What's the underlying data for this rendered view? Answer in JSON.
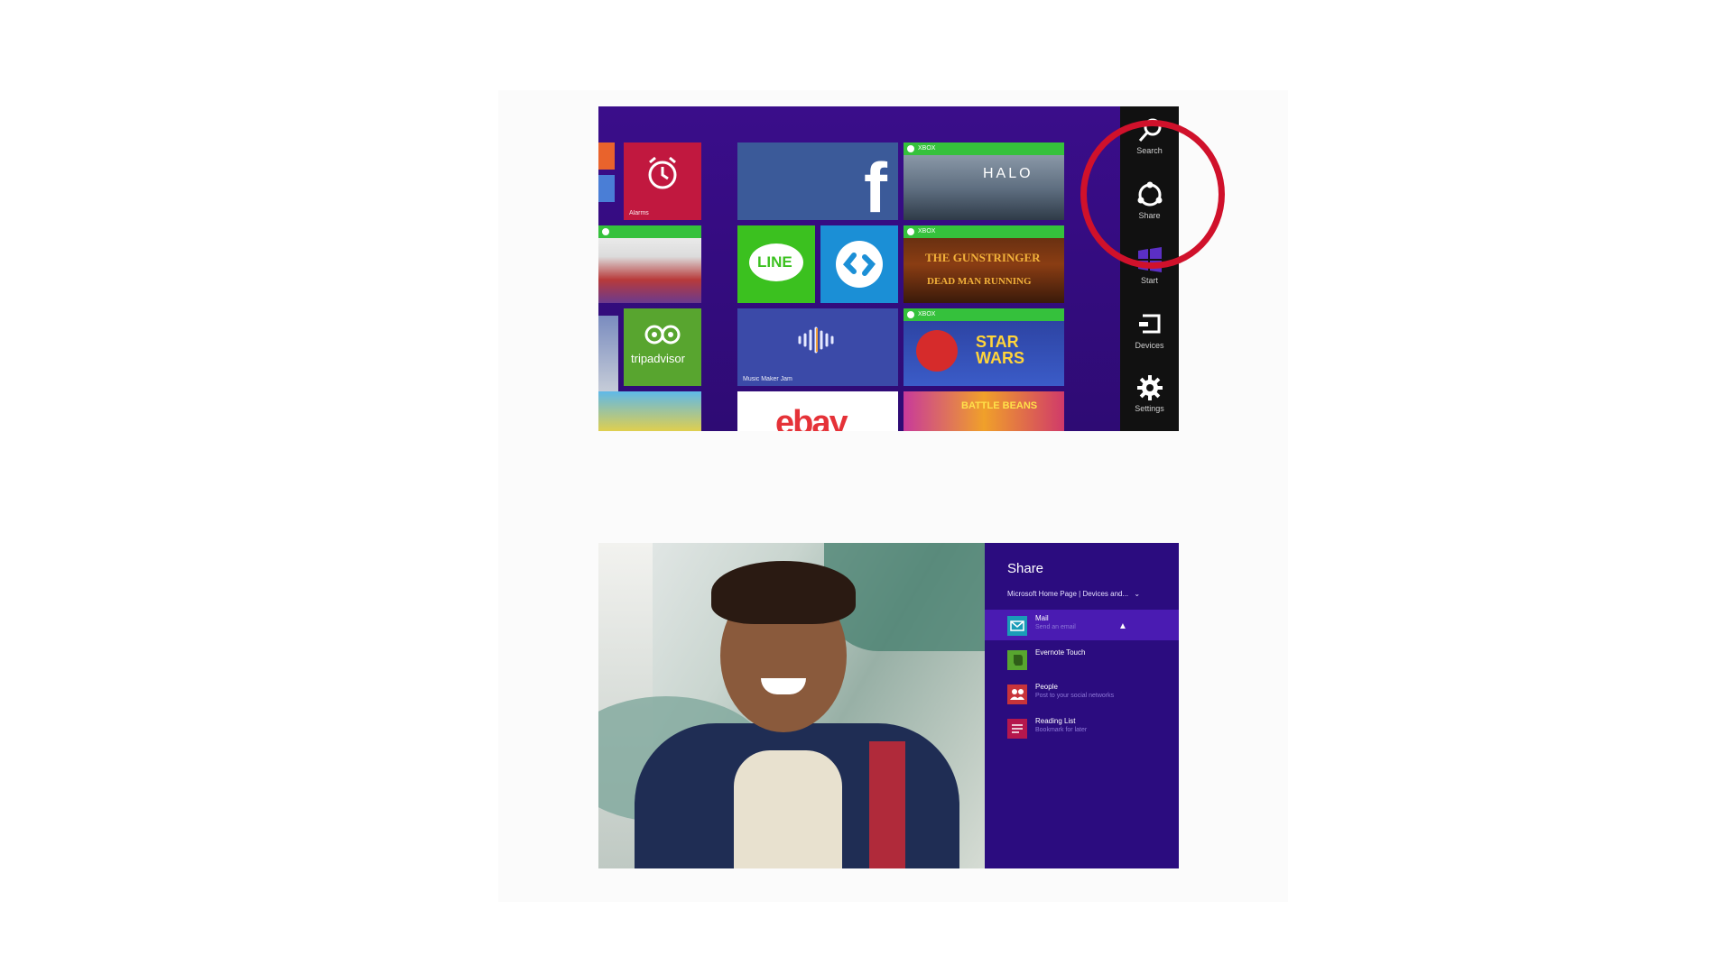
{
  "start_screen": {
    "tiles": {
      "alarms_label": "Alarms",
      "facebook_glyph": "f",
      "line_label": "LINE",
      "tripadvisor_label": "tripadvisor",
      "music_maker_label": "Music Maker Jam",
      "ebay_label": "ebay",
      "xbox_badge": "XBOX",
      "halo_title": "HALO",
      "gunstringer_title": "THE GUNSTRINGER",
      "gunstringer_subtitle": "DEAD MAN RUNNING",
      "starwars_title": "STAR WARS",
      "battle_beans_title": "BATTLE BEANS"
    },
    "charms": {
      "search": "Search",
      "share": "Share",
      "start": "Start",
      "devices": "Devices",
      "settings": "Settings"
    },
    "highlight_color": "#d0112b"
  },
  "share_pane": {
    "title": "Share",
    "source": "Microsoft Home Page | Devices and...",
    "items": [
      {
        "name": "Mail",
        "description": "Send an email",
        "icon": "mail-icon",
        "color": "#1a9cb8"
      },
      {
        "name": "Evernote Touch",
        "description": "",
        "icon": "evernote-icon",
        "color": "#58a52f"
      },
      {
        "name": "People",
        "description": "Post to your social networks",
        "icon": "people-icon",
        "color": "#c8343a"
      },
      {
        "name": "Reading List",
        "description": "Bookmark for later",
        "icon": "reading-list-icon",
        "color": "#b5174d"
      }
    ]
  }
}
